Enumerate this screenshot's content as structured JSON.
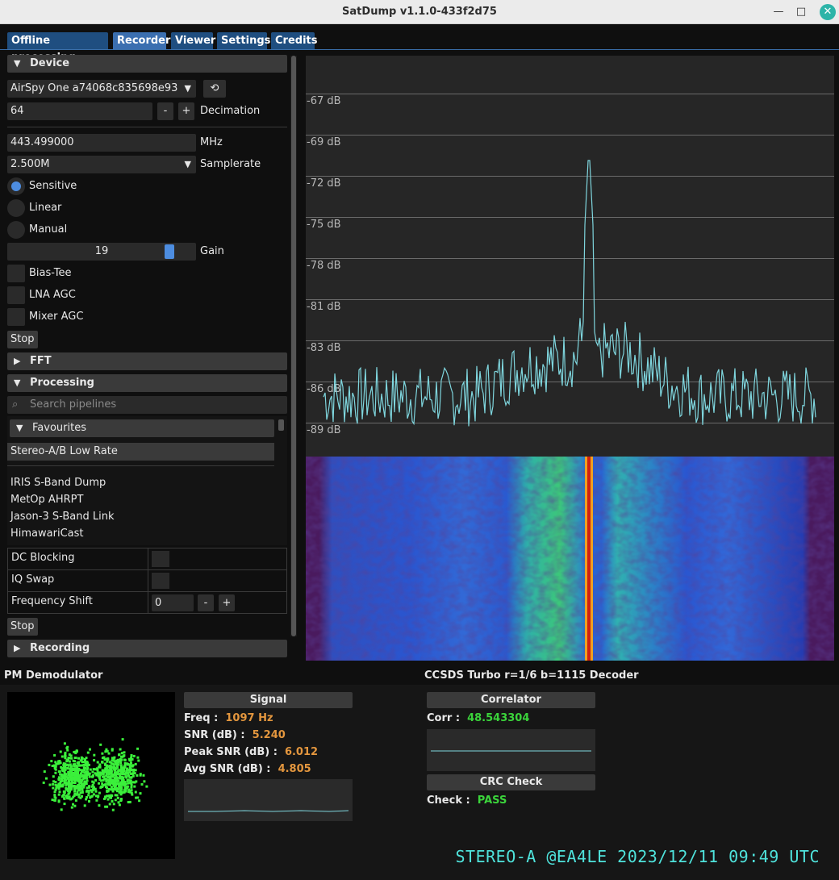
{
  "window": {
    "title": "SatDump v1.1.0-433f2d75",
    "minimize": "—",
    "maximize": "□",
    "close": "✕"
  },
  "tabs": [
    {
      "label": "Offline processing",
      "active": false
    },
    {
      "label": "Recorder",
      "active": true
    },
    {
      "label": "Viewer",
      "active": false
    },
    {
      "label": "Settings",
      "active": false
    },
    {
      "label": "Credits",
      "active": false
    }
  ],
  "device": {
    "header": "Device",
    "selected_device": "AirSpy One a74068c835698e93",
    "refresh_icon": "refresh-icon",
    "decimation_value": "64",
    "decimation_label": "Decimation",
    "minus": "-",
    "plus": "+",
    "frequency_value": "443.499000",
    "frequency_unit": "MHz",
    "samplerate_value": "2.500M",
    "samplerate_label": "Samplerate",
    "gain_modes": [
      {
        "label": "Sensitive",
        "selected": true
      },
      {
        "label": "Linear",
        "selected": false
      },
      {
        "label": "Manual",
        "selected": false
      }
    ],
    "gain_value": "19",
    "gain_level": 0.86,
    "gain_label": "Gain",
    "toggles": [
      {
        "label": "Bias-Tee",
        "checked": false
      },
      {
        "label": "LNA AGC",
        "checked": false
      },
      {
        "label": "Mixer AGC",
        "checked": false
      }
    ],
    "stop_label": "Stop"
  },
  "fft": {
    "header": "FFT"
  },
  "processing": {
    "header": "Processing",
    "search_placeholder": "Search pipelines",
    "favourites_header": "Favourites",
    "selected_pipeline": "Stereo-A/B Low Rate",
    "pipelines": [
      "IRIS S-Band Dump",
      "MetOp AHRPT",
      "Jason-3 S-Band Link",
      "HimawariCast"
    ],
    "options": [
      {
        "label": "DC Blocking",
        "value": ""
      },
      {
        "label": "IQ Swap",
        "value": ""
      },
      {
        "label": "Frequency Shift",
        "value": "0"
      }
    ],
    "stop_label": "Stop"
  },
  "recording": {
    "header": "Recording"
  },
  "spectrum": {
    "db_labels": [
      "-67 dB",
      "-69 dB",
      "-72 dB",
      "-75 dB",
      "-78 dB",
      "-81 dB",
      "-83 dB",
      "-86 dB",
      "-89 dB"
    ],
    "trace_color": "#7fd6de"
  },
  "demod": {
    "title": "PM Demodulator",
    "signal_header": "Signal",
    "freq_label": "Freq :",
    "freq_value": "1097 Hz",
    "snr_label": "SNR (dB) :",
    "snr_value": "5.240",
    "peak_label": "Peak SNR (dB) :",
    "peak_value": "6.012",
    "avg_label": "Avg SNR (dB) :",
    "avg_value": "4.805"
  },
  "decoder": {
    "title": "CCSDS Turbo r=1/6 b=1115 Decoder",
    "correlator_header": "Correlator",
    "corr_label": "Corr :",
    "corr_value": "48.543304",
    "crc_header": "CRC Check",
    "check_label": "Check :",
    "check_value": "PASS"
  },
  "overlay": {
    "text": "STEREO-A @EA4LE 2023/12/11 09:49 UTC"
  },
  "colors": {
    "accent_blue": "#4d8de0",
    "value_orange": "#e3963e",
    "value_green": "#3bd43b",
    "overlay_cyan": "#4fe3dc"
  }
}
